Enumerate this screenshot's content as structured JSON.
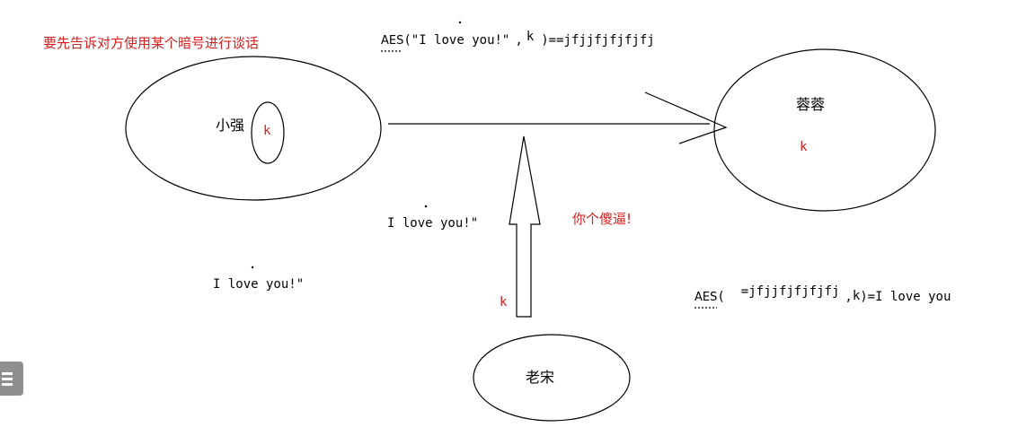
{
  "diagram": {
    "title_note": "要先告诉对方使用某个暗号进行谈话",
    "sender_name": "小强",
    "receiver_name": "蓉蓉",
    "eavesdropper_name": "老宋",
    "key_label": "k",
    "plaintext": "I love you!\"",
    "encrypt": {
      "func": "AES",
      "open": "(\"I love you!\"",
      "sep": ",",
      "close": ")==jfjjfjfjfjfj"
    },
    "decrypt": {
      "func": "AES",
      "open": "(",
      "cipher": "=jfjjfjfjfjfj",
      "sep": ",",
      "key": "k",
      "close": ")=I love you"
    },
    "taunt": "你个傻逼!",
    "colors": {
      "red": "#d81e1e",
      "ink": "#000000"
    }
  }
}
